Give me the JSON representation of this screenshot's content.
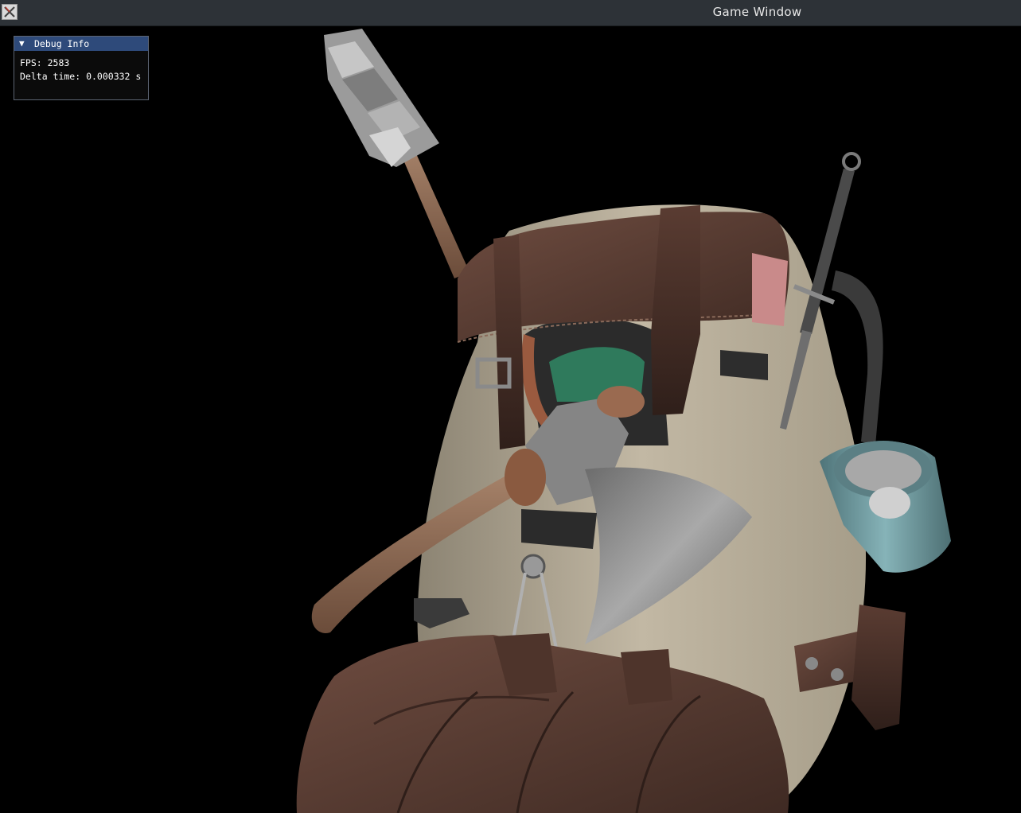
{
  "window": {
    "title": "Game Window",
    "icon": "x11-app-icon"
  },
  "debug_panel": {
    "collapse_glyph": "▼",
    "title": "Debug Info",
    "fps_label": "FPS: 2583",
    "delta_label": "Delta time: 0.000332 s"
  },
  "scene": {
    "subject": "backpack-3d-model",
    "colors": {
      "background": "#000000",
      "titlebar": "#2d3237",
      "panel_header": "#2e4a7a",
      "leather": "#5e4137",
      "canvas": "#b8ad98",
      "steel": "#8a8a8a",
      "wood": "#8a6a52",
      "cup": "#6f9aa0"
    }
  }
}
